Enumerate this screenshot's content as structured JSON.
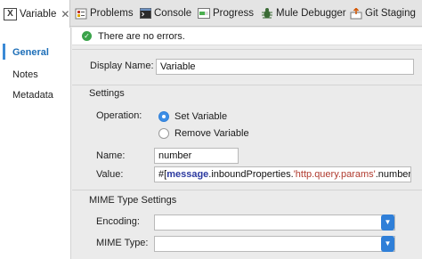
{
  "tabs": {
    "active": {
      "label": "Variable",
      "icon": "x-box-icon"
    },
    "items": [
      {
        "label": "Problems",
        "icon": "problems-icon"
      },
      {
        "label": "Console",
        "icon": "console-icon"
      },
      {
        "label": "Progress",
        "icon": "progress-icon"
      },
      {
        "label": "Mule Debugger",
        "icon": "debugger-icon"
      },
      {
        "label": "Git Staging",
        "icon": "git-staging-icon"
      }
    ]
  },
  "sidebar": {
    "items": [
      {
        "label": "General",
        "selected": true
      },
      {
        "label": "Notes",
        "selected": false
      },
      {
        "label": "Metadata",
        "selected": false
      }
    ]
  },
  "status": {
    "text": "There are no errors."
  },
  "form": {
    "display_name_label": "Display Name:",
    "display_name_value": "Variable",
    "settings_title": "Settings",
    "operation_label": "Operation:",
    "operation_options": [
      "Set Variable",
      "Remove Variable"
    ],
    "operation_selected": "Set Variable",
    "name_label": "Name:",
    "name_value": "number",
    "value_label": "Value:",
    "value_parts": {
      "open": "#[",
      "keyword": "message",
      "mid": ".inboundProperties.",
      "string": "'http.query.params'",
      "end": ".number]"
    },
    "mime_title": "MIME Type Settings",
    "encoding_label": "Encoding:",
    "encoding_value": "",
    "mime_type_label": "MIME Type:",
    "mime_type_value": ""
  },
  "colors": {
    "accent": "#2f7fd8",
    "selected_nav": "#1e6fb8",
    "ok": "#3aa34a"
  }
}
